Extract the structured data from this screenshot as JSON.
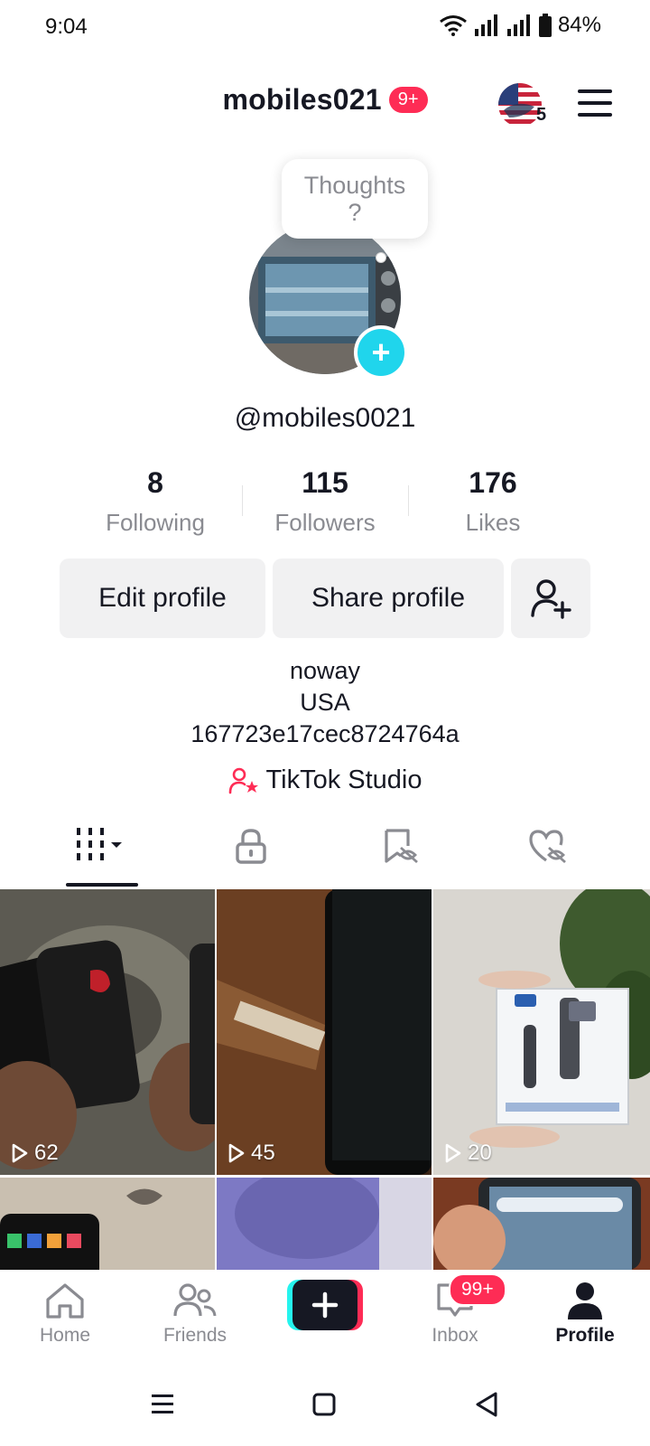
{
  "status_bar": {
    "time": "9:04",
    "battery": "84%"
  },
  "header": {
    "username": "mobiles021",
    "notif_badge": "9+",
    "region_count": "5"
  },
  "bubble": {
    "line1": "Thoughts",
    "line2": "?"
  },
  "profile": {
    "handle": "@mobiles0021"
  },
  "stats": [
    {
      "value": "8",
      "label": "Following"
    },
    {
      "value": "115",
      "label": "Followers"
    },
    {
      "value": "176",
      "label": "Likes"
    }
  ],
  "buttons": {
    "edit": "Edit profile",
    "share": "Share profile"
  },
  "bio": {
    "line1": "noway",
    "line2": "USA",
    "line3": "167723e17cec8724764a"
  },
  "studio": {
    "label": "TikTok Studio"
  },
  "tabs": [
    "videos-grid-icon",
    "lock-icon",
    "bookmark-hidden-icon",
    "liked-hidden-icon"
  ],
  "videos": [
    {
      "views": "62"
    },
    {
      "views": "45"
    },
    {
      "views": "20"
    }
  ],
  "bottom_nav": {
    "home": "Home",
    "friends": "Friends",
    "inbox": "Inbox",
    "inbox_badge": "99+",
    "profile": "Profile"
  },
  "colors": {
    "accent_red": "#fe2c55",
    "accent_cyan": "#20d5ec",
    "text_gray": "#8a8b91"
  }
}
